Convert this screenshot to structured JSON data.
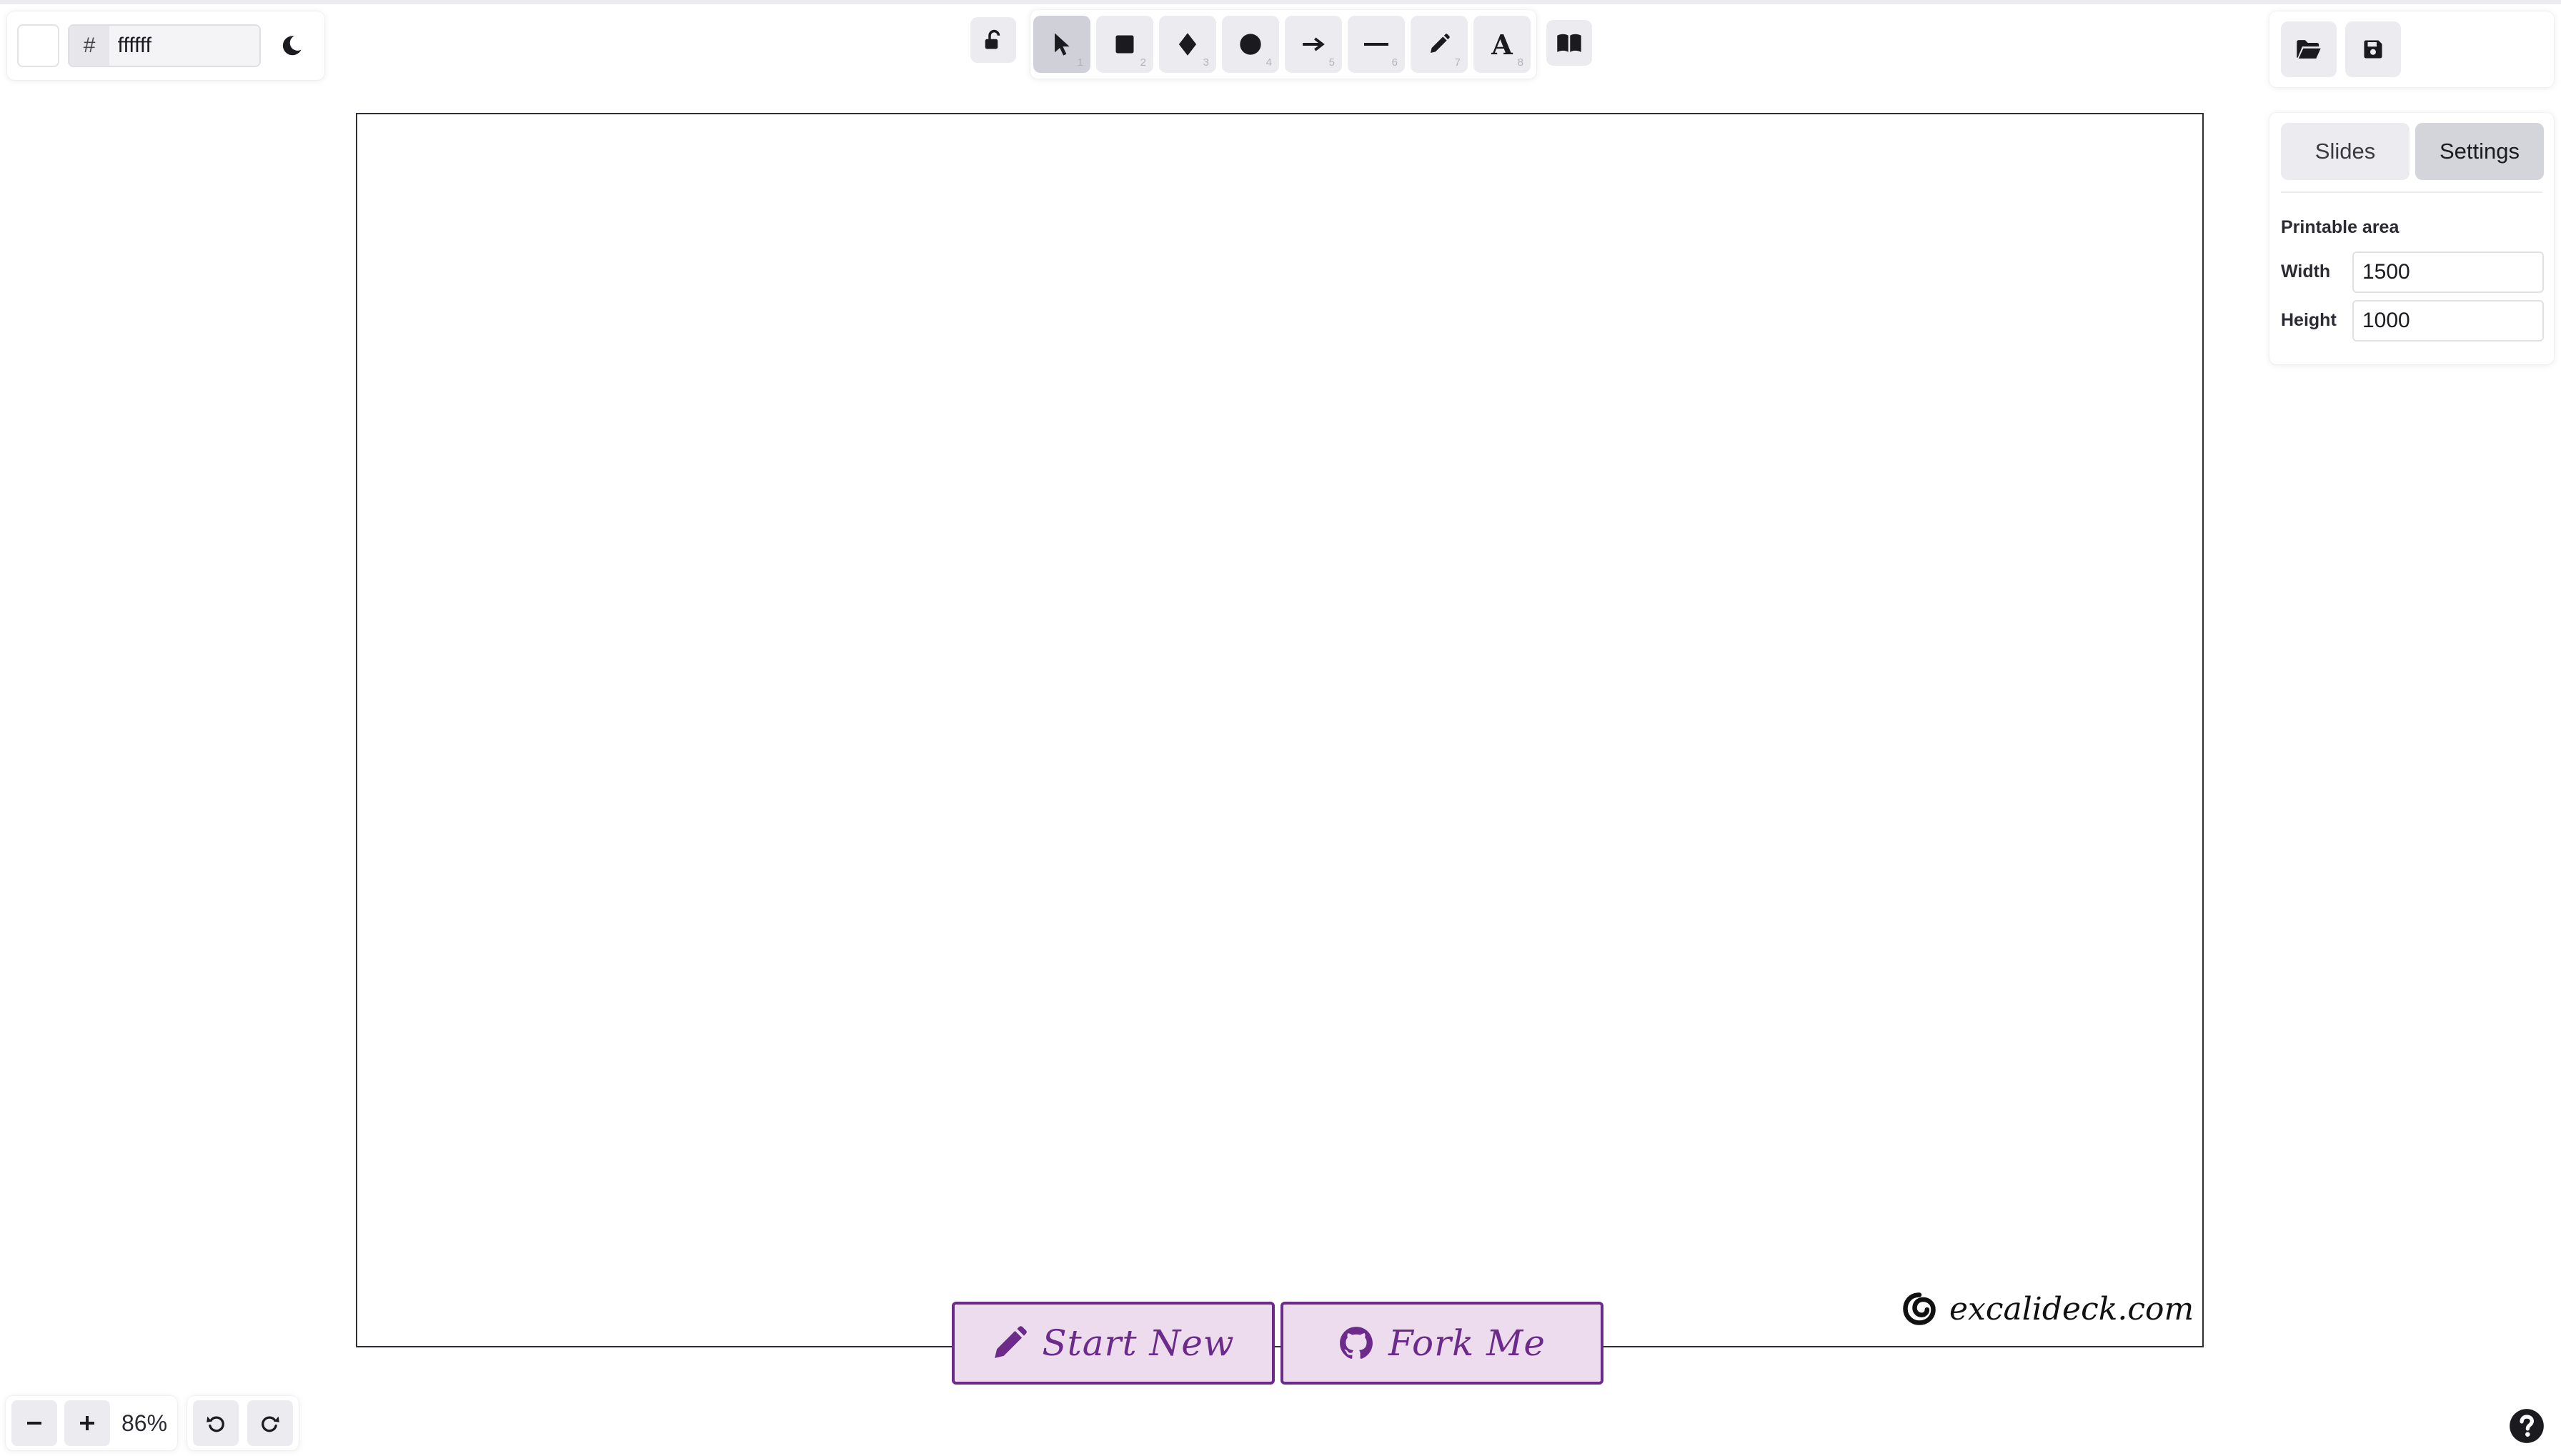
{
  "background": {
    "swatch_color": "#ffffff",
    "hash_symbol": "#",
    "hex_value": "ffffff"
  },
  "toolbar": {
    "tools": [
      {
        "name": "selection",
        "hotkey": "1",
        "icon": "pointer-icon",
        "active": true
      },
      {
        "name": "rectangle",
        "hotkey": "2",
        "icon": "square-icon"
      },
      {
        "name": "diamond",
        "hotkey": "3",
        "icon": "diamond-icon"
      },
      {
        "name": "ellipse",
        "hotkey": "4",
        "icon": "circle-icon"
      },
      {
        "name": "arrow",
        "hotkey": "5",
        "icon": "arrow-right-icon"
      },
      {
        "name": "line",
        "hotkey": "6",
        "icon": "line-icon"
      },
      {
        "name": "draw",
        "hotkey": "7",
        "icon": "pencil-icon"
      },
      {
        "name": "text",
        "hotkey": "8",
        "icon": "text-icon",
        "glyph": "A"
      }
    ],
    "lock_icon": "unlock-icon",
    "library_icon": "book-icon"
  },
  "file_actions": {
    "open_icon": "folder-open-icon",
    "save_icon": "save-icon"
  },
  "sidebar": {
    "tabs": [
      {
        "label": "Slides",
        "active": false
      },
      {
        "label": "Settings",
        "active": true
      }
    ],
    "section_title": "Printable area",
    "width_label": "Width",
    "width_value": "1500",
    "height_label": "Height",
    "height_value": "1000"
  },
  "actions": {
    "start_new_label": "Start New",
    "fork_me_label": "Fork Me"
  },
  "watermark": {
    "text": "excalideck.com"
  },
  "zoom": {
    "minus": "−",
    "plus": "+",
    "level": "86%"
  },
  "colors": {
    "accent": "#6c2a8b",
    "accent_bg": "#ecdcee",
    "button_bg": "#ececf0",
    "button_active": "#d0d0d8"
  }
}
